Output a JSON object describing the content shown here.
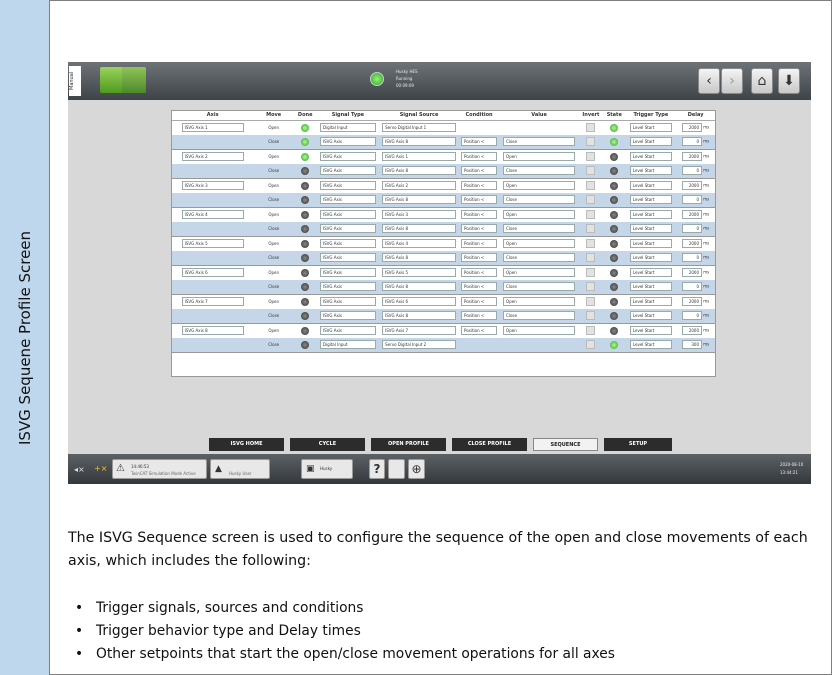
{
  "side_label": "ISVG Sequene Profile Screen",
  "topbar": {
    "mode_label": "Manual",
    "status_lines": [
      "Husky HES",
      "Running",
      "00:09:09"
    ],
    "back_symbol": "‹",
    "forward_symbol": "›",
    "home_symbol": "⌂",
    "download_symbol": "⬇"
  },
  "table": {
    "headers": [
      "Axis",
      "Move",
      "Done",
      "Signal Type",
      "Signal Source",
      "Condition",
      "Value",
      "Invert",
      "State",
      "Trigger Type",
      "Delay"
    ],
    "delay_unit": "ms",
    "rows": [
      {
        "axis": "ISVG Axis 1",
        "move": "Open",
        "done": "on",
        "signal_type": "Digital Input",
        "signal_source": "Servo Digital Input 1",
        "condition": "",
        "value": "",
        "state": "on",
        "trigger": "Level Start",
        "delay": "2000"
      },
      {
        "axis": "",
        "move": "Close",
        "done": "on",
        "signal_type": "ISVG Axis",
        "signal_source": "ISVG Axis 8",
        "condition": "Position <",
        "value": "Close",
        "state": "on",
        "trigger": "Level Start",
        "delay": "0"
      },
      {
        "axis": "ISVG Axis 2",
        "move": "Open",
        "done": "on",
        "signal_type": "ISVG Axis",
        "signal_source": "ISVG Axis 1",
        "condition": "Position <",
        "value": "Open",
        "state": "off",
        "trigger": "Level Start",
        "delay": "2000"
      },
      {
        "axis": "",
        "move": "Close",
        "done": "off",
        "signal_type": "ISVG Axis",
        "signal_source": "ISVG Axis 8",
        "condition": "Position <",
        "value": "Close",
        "state": "off",
        "trigger": "Level Start",
        "delay": "0"
      },
      {
        "axis": "ISVG Axis 3",
        "move": "Open",
        "done": "off",
        "signal_type": "ISVG Axis",
        "signal_source": "ISVG Axis 2",
        "condition": "Position <",
        "value": "Open",
        "state": "off",
        "trigger": "Level Start",
        "delay": "2000"
      },
      {
        "axis": "",
        "move": "Close",
        "done": "off",
        "signal_type": "ISVG Axis",
        "signal_source": "ISVG Axis 8",
        "condition": "Position <",
        "value": "Close",
        "state": "off",
        "trigger": "Level Start",
        "delay": "0"
      },
      {
        "axis": "ISVG Axis 4",
        "move": "Open",
        "done": "off",
        "signal_type": "ISVG Axis",
        "signal_source": "ISVG Axis 3",
        "condition": "Position <",
        "value": "Open",
        "state": "off",
        "trigger": "Level Start",
        "delay": "2000"
      },
      {
        "axis": "",
        "move": "Close",
        "done": "off",
        "signal_type": "ISVG Axis",
        "signal_source": "ISVG Axis 8",
        "condition": "Position <",
        "value": "Close",
        "state": "off",
        "trigger": "Level Start",
        "delay": "0"
      },
      {
        "axis": "ISVG Axis 5",
        "move": "Open",
        "done": "off",
        "signal_type": "ISVG Axis",
        "signal_source": "ISVG Axis 4",
        "condition": "Position <",
        "value": "Open",
        "state": "off",
        "trigger": "Level Start",
        "delay": "2000"
      },
      {
        "axis": "",
        "move": "Close",
        "done": "off",
        "signal_type": "ISVG Axis",
        "signal_source": "ISVG Axis 8",
        "condition": "Position <",
        "value": "Close",
        "state": "off",
        "trigger": "Level Start",
        "delay": "0"
      },
      {
        "axis": "ISVG Axis 6",
        "move": "Open",
        "done": "off",
        "signal_type": "ISVG Axis",
        "signal_source": "ISVG Axis 5",
        "condition": "Position <",
        "value": "Open",
        "state": "off",
        "trigger": "Level Start",
        "delay": "2000"
      },
      {
        "axis": "",
        "move": "Close",
        "done": "off",
        "signal_type": "ISVG Axis",
        "signal_source": "ISVG Axis 8",
        "condition": "Position <",
        "value": "Close",
        "state": "off",
        "trigger": "Level Start",
        "delay": "0"
      },
      {
        "axis": "ISVG Axis 7",
        "move": "Open",
        "done": "off",
        "signal_type": "ISVG Axis",
        "signal_source": "ISVG Axis 6",
        "condition": "Position <",
        "value": "Open",
        "state": "off",
        "trigger": "Level Start",
        "delay": "2000"
      },
      {
        "axis": "",
        "move": "Close",
        "done": "off",
        "signal_type": "ISVG Axis",
        "signal_source": "ISVG Axis 8",
        "condition": "Position <",
        "value": "Close",
        "state": "off",
        "trigger": "Level Start",
        "delay": "0"
      },
      {
        "axis": "ISVG Axis 8",
        "move": "Open",
        "done": "off",
        "signal_type": "ISVG Axis",
        "signal_source": "ISVG Axis 7",
        "condition": "Position <",
        "value": "Open",
        "state": "off",
        "trigger": "Level Start",
        "delay": "2000"
      },
      {
        "axis": "",
        "move": "Close",
        "done": "off",
        "signal_type": "Digital Input",
        "signal_source": "Servo Digital Input 2",
        "condition": "",
        "value": "",
        "state": "on",
        "trigger": "Level Start",
        "delay": "300"
      }
    ]
  },
  "tabs": [
    {
      "label": "ISVG HOME",
      "active": false
    },
    {
      "label": "CYCLE",
      "active": false
    },
    {
      "label": "OPEN PROFILE",
      "active": false
    },
    {
      "label": "CLOSE PROFILE",
      "active": false
    },
    {
      "label": "SEQUENCE",
      "active": true
    },
    {
      "label": "SETUP",
      "active": false
    }
  ],
  "bottombar": {
    "alarm_time": "14:46:53",
    "alarm_text": "TwinCAT Simulation Mode Active",
    "user_text": "Husky User",
    "machine_text": "Husky",
    "help_symbol": "?",
    "clock_date": "2020-08-10",
    "clock_time": "13:44:21"
  },
  "description": "The ISVG Sequence screen is used to configure the sequence of the open and close movements of each axis, which includes the following:",
  "bullets": [
    "Trigger signals, sources and conditions",
    "Trigger behavior type and Delay times",
    "Other setpoints that start the open/close movement operations for all axes"
  ],
  "colors": {
    "side_tab": "#bfd7ec",
    "close_row": "#c5d6e8",
    "led_on": "#2aa81d",
    "tab_dark": "#2c2c2c"
  }
}
